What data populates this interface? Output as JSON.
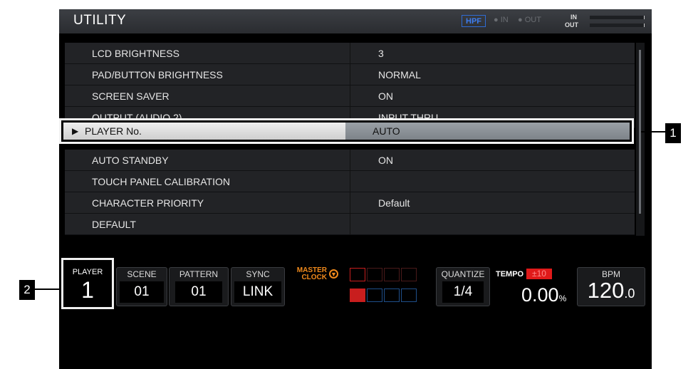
{
  "window": {
    "title": "UTILITY"
  },
  "header": {
    "hpf": "HPF",
    "in_label": "IN",
    "out_label": "OUT",
    "meter_in": "IN",
    "meter_out": "OUT"
  },
  "menu": {
    "items": [
      {
        "label": "LCD BRIGHTNESS",
        "value": "3"
      },
      {
        "label": "PAD/BUTTON BRIGHTNESS",
        "value": "NORMAL"
      },
      {
        "label": "SCREEN SAVER",
        "value": "ON"
      },
      {
        "label": "OUTPUT (AUDIO 2)",
        "value": "INPUT THRU"
      },
      {
        "label": "PLAYER No.",
        "value": "AUTO"
      },
      {
        "label": "AUTO STANDBY",
        "value": "ON"
      },
      {
        "label": "TOUCH PANEL CALIBRATION",
        "value": ""
      },
      {
        "label": "CHARACTER PRIORITY",
        "value": "Default"
      },
      {
        "label": "DEFAULT",
        "value": ""
      }
    ],
    "selected_arrow": "▶"
  },
  "callouts": {
    "one": "1",
    "two": "2"
  },
  "status": {
    "player_label": "PLAYER",
    "player_value": "1",
    "scene_label": "SCENE",
    "scene_value": "01",
    "pattern_label": "PATTERN",
    "pattern_value": "01",
    "sync_label": "SYNC",
    "sync_value": "LINK",
    "master_clock": "MASTER",
    "master_clock2": "CLOCK",
    "quantize_label": "QUANTIZE",
    "quantize_value": "1/4",
    "tempo_label": "TEMPO",
    "tempo_range": "±10",
    "tempo_value": "0.00",
    "tempo_unit": "%",
    "bpm_label": "BPM",
    "bpm_value": "120",
    "bpm_decimal": ".0"
  },
  "colors": {
    "accent_orange": "#f08a1c",
    "tempo_red": "#e01a1a",
    "pad_red": "#c81e1e",
    "pad_blue": "#1f4f8a",
    "hpf_blue": "#2f6cd6"
  }
}
